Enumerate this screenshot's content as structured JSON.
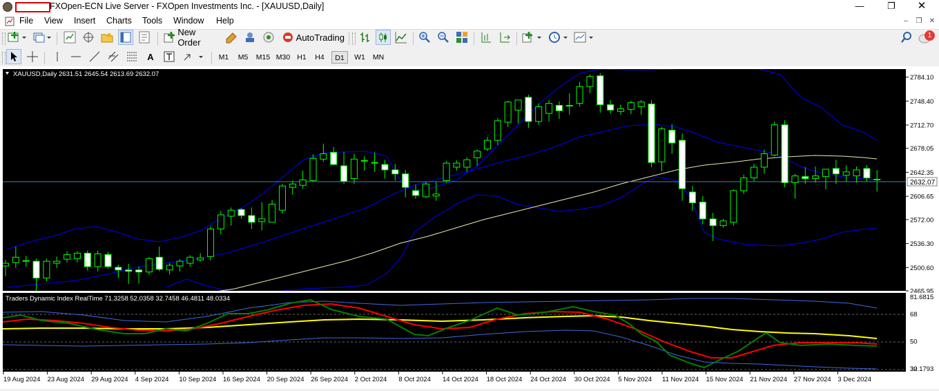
{
  "window": {
    "title": "FXOpen-ECN Live Server - FXOpen Investments Inc. - [XAUUSD,Daily]",
    "minimize_icon": "minimize-icon",
    "maximize_icon": "restore-icon",
    "close_icon": "close-icon"
  },
  "menu": [
    "File",
    "View",
    "Insert",
    "Charts",
    "Tools",
    "Window",
    "Help"
  ],
  "toolbar": {
    "new_order_label": "New Order",
    "autotrading_label": "AutoTrading",
    "notification_count": "1"
  },
  "timeframes": [
    "M1",
    "M5",
    "M15",
    "M30",
    "H1",
    "H4",
    "D1",
    "W1",
    "MN"
  ],
  "active_timeframe": "D1",
  "chart": {
    "info": "XAUUSD,Daily  2631.51 2645.54 2613.69 2632.07",
    "symbol": "XAUUSD",
    "period": "Daily",
    "ohlc": {
      "open": 2631.51,
      "high": 2645.54,
      "low": 2613.69,
      "close": 2632.07
    },
    "current_price_label": "2632.07",
    "price_axis": [
      "2784.10",
      "2748.40",
      "2712.70",
      "2678.05",
      "2642.35",
      "2606.65",
      "2572.00",
      "2536.30",
      "2500.60",
      "2465.95"
    ],
    "indicator_info": "Traders Dynamic Index RealTime 71.3258 52.0358 32.7458 46.4811 48.0334",
    "indicator_axis": [
      "81.6815",
      "68",
      "50",
      "32",
      "30.1793"
    ],
    "date_axis": [
      "19 Aug 2024",
      "23 Aug 2024",
      "29 Aug 2024",
      "4 Sep 2024",
      "10 Sep 2024",
      "16 Sep 2024",
      "20 Sep 2024",
      "26 Sep 2024",
      "2 Oct 2024",
      "8 Oct 2024",
      "14 Oct 2024",
      "18 Oct 2024",
      "24 Oct 2024",
      "30 Oct 2024",
      "5 Nov 2024",
      "11 Nov 2024",
      "15 Nov 2024",
      "21 Nov 2024",
      "27 Nov 2024",
      "3 Dec 2024"
    ],
    "colors": {
      "background": "#000000",
      "bull": "#00ff00",
      "bear": "#ffffff",
      "bollinger": "#0000ff",
      "ma": "#eee8aa",
      "tdi_signal": "#ff0000",
      "tdi_rsi": "#008000",
      "tdi_base": "#ffff00",
      "tdi_bands": "#4169e1"
    }
  },
  "chart_data": {
    "type": "candlestick",
    "symbol": "XAUUSD",
    "timeframe": "Daily",
    "ylim": [
      2465.95,
      2796.0
    ],
    "candles": [
      {
        "o": 2503,
        "h": 2512,
        "l": 2488,
        "c": 2507
      },
      {
        "o": 2508,
        "h": 2532,
        "l": 2500,
        "c": 2516
      },
      {
        "o": 2510,
        "h": 2518,
        "l": 2502,
        "c": 2511
      },
      {
        "o": 2510,
        "h": 2514,
        "l": 2466,
        "c": 2485
      },
      {
        "o": 2485,
        "h": 2514,
        "l": 2480,
        "c": 2510
      },
      {
        "o": 2507,
        "h": 2517,
        "l": 2500,
        "c": 2510
      },
      {
        "o": 2513,
        "h": 2525,
        "l": 2508,
        "c": 2520
      },
      {
        "o": 2514,
        "h": 2525,
        "l": 2508,
        "c": 2522
      },
      {
        "o": 2522,
        "h": 2526,
        "l": 2496,
        "c": 2502
      },
      {
        "o": 2502,
        "h": 2526,
        "l": 2495,
        "c": 2521
      },
      {
        "o": 2520,
        "h": 2524,
        "l": 2499,
        "c": 2502
      },
      {
        "o": 2501,
        "h": 2505,
        "l": 2485,
        "c": 2497
      },
      {
        "o": 2497,
        "h": 2506,
        "l": 2476,
        "c": 2495
      },
      {
        "o": 2497,
        "h": 2502,
        "l": 2477,
        "c": 2494
      },
      {
        "o": 2494,
        "h": 2516,
        "l": 2490,
        "c": 2514
      },
      {
        "o": 2516,
        "h": 2532,
        "l": 2495,
        "c": 2498
      },
      {
        "o": 2497,
        "h": 2507,
        "l": 2490,
        "c": 2504
      },
      {
        "o": 2503,
        "h": 2513,
        "l": 2495,
        "c": 2510
      },
      {
        "o": 2507,
        "h": 2519,
        "l": 2502,
        "c": 2516
      },
      {
        "o": 2512,
        "h": 2522,
        "l": 2510,
        "c": 2515
      },
      {
        "o": 2517,
        "h": 2562,
        "l": 2511,
        "c": 2558
      },
      {
        "o": 2558,
        "h": 2585,
        "l": 2550,
        "c": 2579
      },
      {
        "o": 2577,
        "h": 2590,
        "l": 2563,
        "c": 2586
      },
      {
        "o": 2587,
        "h": 2589,
        "l": 2573,
        "c": 2578
      },
      {
        "o": 2578,
        "h": 2590,
        "l": 2558,
        "c": 2568
      },
      {
        "o": 2569,
        "h": 2598,
        "l": 2556,
        "c": 2573
      },
      {
        "o": 2568,
        "h": 2601,
        "l": 2568,
        "c": 2595
      },
      {
        "o": 2586,
        "h": 2625,
        "l": 2581,
        "c": 2622
      },
      {
        "o": 2620,
        "h": 2630,
        "l": 2609,
        "c": 2625
      },
      {
        "o": 2623,
        "h": 2645,
        "l": 2618,
        "c": 2631
      },
      {
        "o": 2630,
        "h": 2669,
        "l": 2628,
        "c": 2663
      },
      {
        "o": 2662,
        "h": 2685,
        "l": 2658,
        "c": 2670
      },
      {
        "o": 2672,
        "h": 2680,
        "l": 2653,
        "c": 2654
      },
      {
        "o": 2652,
        "h": 2673,
        "l": 2625,
        "c": 2629
      },
      {
        "o": 2633,
        "h": 2670,
        "l": 2625,
        "c": 2662
      },
      {
        "o": 2660,
        "h": 2666,
        "l": 2645,
        "c": 2659
      },
      {
        "o": 2657,
        "h": 2672,
        "l": 2643,
        "c": 2656
      },
      {
        "o": 2654,
        "h": 2661,
        "l": 2633,
        "c": 2646
      },
      {
        "o": 2646,
        "h": 2655,
        "l": 2630,
        "c": 2640
      },
      {
        "o": 2640,
        "h": 2646,
        "l": 2605,
        "c": 2620
      },
      {
        "o": 2615,
        "h": 2624,
        "l": 2603,
        "c": 2608
      },
      {
        "o": 2606,
        "h": 2628,
        "l": 2604,
        "c": 2625
      },
      {
        "o": 2607,
        "h": 2628,
        "l": 2600,
        "c": 2610
      },
      {
        "o": 2630,
        "h": 2659,
        "l": 2627,
        "c": 2656
      },
      {
        "o": 2650,
        "h": 2660,
        "l": 2645,
        "c": 2656
      },
      {
        "o": 2650,
        "h": 2665,
        "l": 2643,
        "c": 2661
      },
      {
        "o": 2664,
        "h": 2676,
        "l": 2652,
        "c": 2674
      },
      {
        "o": 2677,
        "h": 2695,
        "l": 2674,
        "c": 2690
      },
      {
        "o": 2690,
        "h": 2723,
        "l": 2683,
        "c": 2719
      },
      {
        "o": 2717,
        "h": 2749,
        "l": 2710,
        "c": 2747
      },
      {
        "o": 2735,
        "h": 2750,
        "l": 2715,
        "c": 2750
      },
      {
        "o": 2754,
        "h": 2758,
        "l": 2708,
        "c": 2718
      },
      {
        "o": 2718,
        "h": 2745,
        "l": 2713,
        "c": 2740
      },
      {
        "o": 2730,
        "h": 2750,
        "l": 2718,
        "c": 2745
      },
      {
        "o": 2742,
        "h": 2748,
        "l": 2722,
        "c": 2734
      },
      {
        "o": 2742,
        "h": 2760,
        "l": 2728,
        "c": 2742
      },
      {
        "o": 2745,
        "h": 2777,
        "l": 2740,
        "c": 2770
      },
      {
        "o": 2770,
        "h": 2788,
        "l": 2760,
        "c": 2785
      },
      {
        "o": 2786,
        "h": 2790,
        "l": 2731,
        "c": 2743
      },
      {
        "o": 2743,
        "h": 2750,
        "l": 2730,
        "c": 2735
      },
      {
        "o": 2733,
        "h": 2743,
        "l": 2728,
        "c": 2737
      },
      {
        "o": 2736,
        "h": 2749,
        "l": 2729,
        "c": 2746
      },
      {
        "o": 2740,
        "h": 2750,
        "l": 2728,
        "c": 2747
      },
      {
        "o": 2744,
        "h": 2750,
        "l": 2650,
        "c": 2657
      },
      {
        "o": 2658,
        "h": 2710,
        "l": 2644,
        "c": 2707
      },
      {
        "o": 2705,
        "h": 2714,
        "l": 2670,
        "c": 2686
      },
      {
        "o": 2690,
        "h": 2700,
        "l": 2600,
        "c": 2618
      },
      {
        "o": 2613,
        "h": 2622,
        "l": 2585,
        "c": 2597
      },
      {
        "o": 2598,
        "h": 2607,
        "l": 2565,
        "c": 2573
      },
      {
        "o": 2573,
        "h": 2582,
        "l": 2540,
        "c": 2563
      },
      {
        "o": 2563,
        "h": 2573,
        "l": 2560,
        "c": 2570
      },
      {
        "o": 2568,
        "h": 2617,
        "l": 2563,
        "c": 2615
      },
      {
        "o": 2615,
        "h": 2639,
        "l": 2610,
        "c": 2634
      },
      {
        "o": 2634,
        "h": 2655,
        "l": 2629,
        "c": 2650
      },
      {
        "o": 2650,
        "h": 2676,
        "l": 2640,
        "c": 2670
      },
      {
        "o": 2668,
        "h": 2718,
        "l": 2666,
        "c": 2713
      },
      {
        "o": 2713,
        "h": 2720,
        "l": 2620,
        "c": 2627
      },
      {
        "o": 2627,
        "h": 2640,
        "l": 2603,
        "c": 2637
      },
      {
        "o": 2636,
        "h": 2650,
        "l": 2625,
        "c": 2633
      },
      {
        "o": 2633,
        "h": 2651,
        "l": 2627,
        "c": 2637
      },
      {
        "o": 2636,
        "h": 2647,
        "l": 2617,
        "c": 2647
      },
      {
        "o": 2648,
        "h": 2661,
        "l": 2625,
        "c": 2640
      },
      {
        "o": 2638,
        "h": 2653,
        "l": 2628,
        "c": 2643
      },
      {
        "o": 2637,
        "h": 2651,
        "l": 2627,
        "c": 2646
      },
      {
        "o": 2648,
        "h": 2653,
        "l": 2628,
        "c": 2634
      },
      {
        "o": 2631.51,
        "h": 2645.54,
        "l": 2613.69,
        "c": 2632.07
      }
    ],
    "indicator": {
      "name": "Traders Dynamic Index RealTime",
      "values": [
        71.3258,
        52.0358,
        32.7458,
        46.4811,
        48.0334
      ],
      "ylim": [
        30.1793,
        81.6815
      ],
      "levels": [
        68,
        50,
        32
      ]
    },
    "x_labels": [
      "19 Aug 2024",
      "23 Aug 2024",
      "29 Aug 2024",
      "4 Sep 2024",
      "10 Sep 2024",
      "16 Sep 2024",
      "20 Sep 2024",
      "26 Sep 2024",
      "2 Oct 2024",
      "8 Oct 2024",
      "14 Oct 2024",
      "18 Oct 2024",
      "24 Oct 2024",
      "30 Oct 2024",
      "5 Nov 2024",
      "11 Nov 2024",
      "15 Nov 2024",
      "21 Nov 2024",
      "27 Nov 2024",
      "3 Dec 2024"
    ]
  }
}
